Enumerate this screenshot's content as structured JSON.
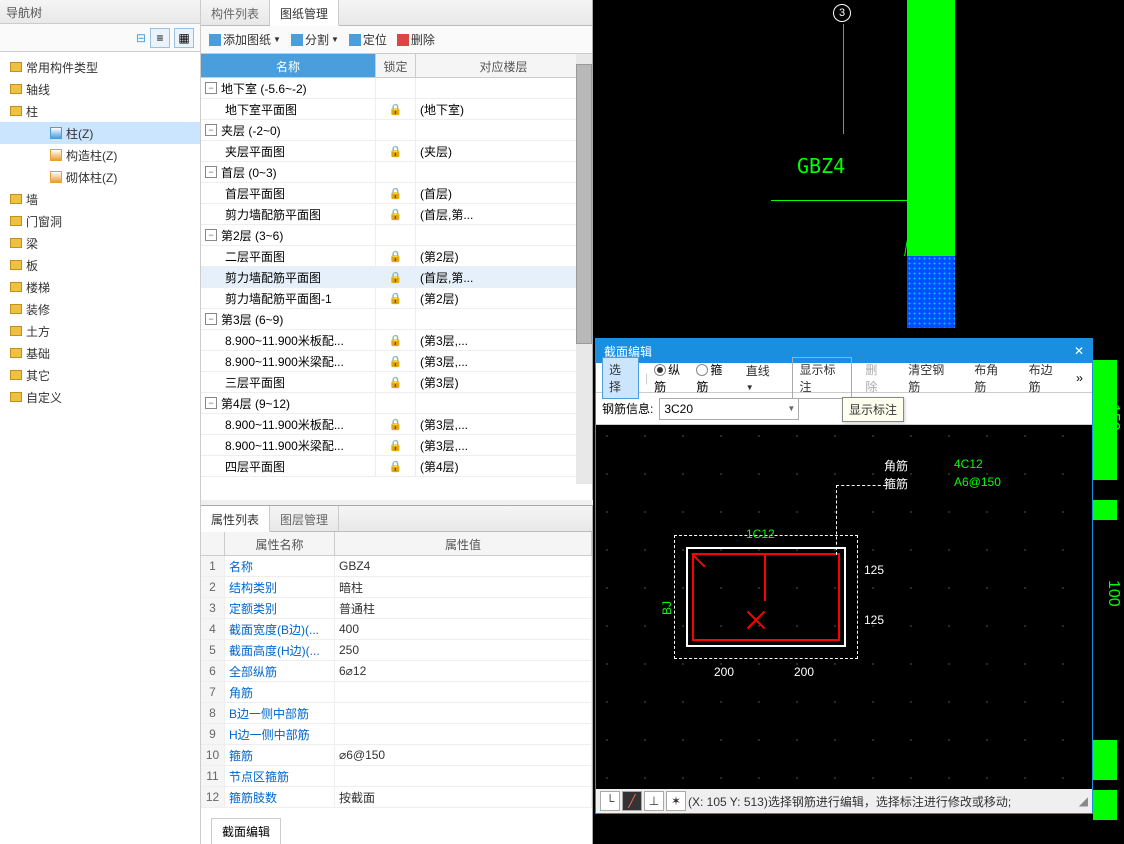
{
  "nav": {
    "title": "导航树",
    "items": [
      {
        "label": "常用构件类型",
        "lvl": 0
      },
      {
        "label": "轴线",
        "lvl": 0
      },
      {
        "label": "柱",
        "lvl": 0
      },
      {
        "label": "柱(Z)",
        "lvl": 2,
        "selected": true,
        "icon": "col-blue"
      },
      {
        "label": "构造柱(Z)",
        "lvl": 2,
        "icon": "col-orange"
      },
      {
        "label": "砌体柱(Z)",
        "lvl": 2,
        "icon": "col-orange"
      },
      {
        "label": "墙",
        "lvl": 0
      },
      {
        "label": "门窗洞",
        "lvl": 0
      },
      {
        "label": "梁",
        "lvl": 0
      },
      {
        "label": "板",
        "lvl": 0
      },
      {
        "label": "楼梯",
        "lvl": 0
      },
      {
        "label": "装修",
        "lvl": 0
      },
      {
        "label": "土方",
        "lvl": 0
      },
      {
        "label": "基础",
        "lvl": 0
      },
      {
        "label": "其它",
        "lvl": 0
      },
      {
        "label": "自定义",
        "lvl": 0
      }
    ]
  },
  "mid": {
    "tabs": [
      "构件列表",
      "图纸管理"
    ],
    "active_tab": 1,
    "toolbar": [
      {
        "label": "添加图纸",
        "dd": true,
        "icon": "plus"
      },
      {
        "label": "分割",
        "dd": true,
        "icon": "scissors"
      },
      {
        "label": "定位",
        "icon": "target"
      },
      {
        "label": "删除",
        "icon": "delete"
      }
    ],
    "headers": [
      "名称",
      "锁定",
      "对应楼层"
    ],
    "rows": [
      {
        "type": "group",
        "label": "地下室 (-5.6~-2)"
      },
      {
        "type": "item",
        "label": "地下室平面图",
        "lock": true,
        "floor": "(地下室)"
      },
      {
        "type": "group",
        "label": "夹层 (-2~0)"
      },
      {
        "type": "item",
        "label": "夹层平面图",
        "lock": true,
        "floor": "(夹层)"
      },
      {
        "type": "group",
        "label": "首层 (0~3)"
      },
      {
        "type": "item",
        "label": "首层平面图",
        "lock": true,
        "floor": "(首层)"
      },
      {
        "type": "item",
        "label": "剪力墙配筋平面图",
        "lock": true,
        "floor": "(首层,第..."
      },
      {
        "type": "group",
        "label": "第2层 (3~6)"
      },
      {
        "type": "item",
        "label": "二层平面图",
        "lock": true,
        "floor": "(第2层)"
      },
      {
        "type": "item",
        "label": "剪力墙配筋平面图",
        "lock": true,
        "floor": "(首层,第...",
        "sel": true
      },
      {
        "type": "item",
        "label": "剪力墙配筋平面图-1",
        "lock": true,
        "floor": "(第2层)"
      },
      {
        "type": "group",
        "label": "第3层 (6~9)"
      },
      {
        "type": "item",
        "label": "8.900~11.900米板配...",
        "lock": true,
        "floor": "(第3层,..."
      },
      {
        "type": "item",
        "label": "8.900~11.900米梁配...",
        "lock": true,
        "floor": "(第3层,..."
      },
      {
        "type": "item",
        "label": "三层平面图",
        "lock": true,
        "floor": "(第3层)"
      },
      {
        "type": "group",
        "label": "第4层 (9~12)"
      },
      {
        "type": "item",
        "label": "8.900~11.900米板配...",
        "lock": true,
        "floor": "(第3层,..."
      },
      {
        "type": "item",
        "label": "8.900~11.900米梁配...",
        "lock": true,
        "floor": "(第3层,..."
      },
      {
        "type": "item",
        "label": "四层平面图",
        "lock": true,
        "floor": "(第4层)"
      }
    ]
  },
  "prop": {
    "tabs": [
      "属性列表",
      "图层管理"
    ],
    "active_tab": 0,
    "headers": [
      "属性名称",
      "属性值"
    ],
    "rows": [
      {
        "n": 1,
        "name": "名称",
        "value": "GBZ4"
      },
      {
        "n": 2,
        "name": "结构类别",
        "value": "暗柱"
      },
      {
        "n": 3,
        "name": "定额类别",
        "value": "普通柱"
      },
      {
        "n": 4,
        "name": "截面宽度(B边)(...",
        "value": "400"
      },
      {
        "n": 5,
        "name": "截面高度(H边)(...",
        "value": "250"
      },
      {
        "n": 6,
        "name": "全部纵筋",
        "value": "6⌀12"
      },
      {
        "n": 7,
        "name": "角筋",
        "value": ""
      },
      {
        "n": 8,
        "name": "B边一侧中部筋",
        "value": ""
      },
      {
        "n": 9,
        "name": "H边一侧中部筋",
        "value": ""
      },
      {
        "n": 10,
        "name": "箍筋",
        "value": "⌀6@150"
      },
      {
        "n": 11,
        "name": "节点区箍筋",
        "value": ""
      },
      {
        "n": 12,
        "name": "箍筋肢数",
        "value": "按截面"
      }
    ],
    "bottom_tab": "截面编辑"
  },
  "cad": {
    "label": "GBZ4",
    "axis_number": "3"
  },
  "sect": {
    "title": "截面编辑",
    "toolbar": {
      "select": "选择",
      "longitudinal": "纵筋",
      "stirrup": "箍筋",
      "line": "直线",
      "show_annot": "显示标注",
      "delete": "删除",
      "clear_rebar": "清空钢筋",
      "corner": "布角筋",
      "edge": "布边筋"
    },
    "tooltip": "显示标注",
    "info_label": "钢筋信息:",
    "info_value": "3C20",
    "annotations": {
      "corner_label": "角筋",
      "stirrup_label": "箍筋",
      "corner_val": "4C12",
      "stirrup_val": "A6@150",
      "top": "1C12",
      "h_label": "BJ",
      "dim_h1": "125",
      "dim_h2": "125",
      "dim_w1": "200",
      "dim_w2": "200"
    },
    "status": "(X: 105 Y: 513)选择钢筋进行编辑，选择标注进行修改或移动;"
  }
}
